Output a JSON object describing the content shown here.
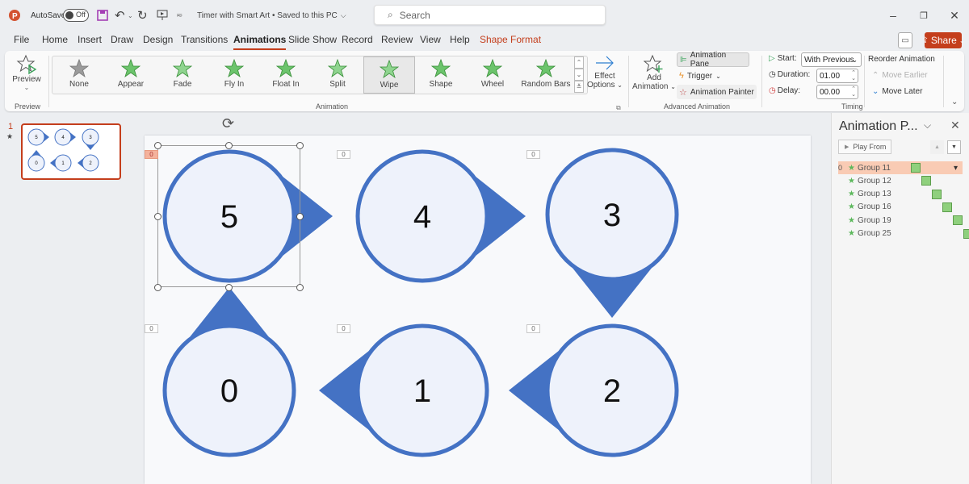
{
  "titlebar": {
    "app_icon": "powerpoint-logo",
    "autosave_label": "AutoSave",
    "autosave_state": "Off",
    "document_title": "Timer with Smart Art • Saved to this PC",
    "search_placeholder": "Search",
    "icons": [
      "save-icon",
      "undo-icon",
      "redo-icon",
      "present-icon",
      "customize-icon"
    ],
    "window_buttons": [
      "minimize",
      "restore",
      "close"
    ]
  },
  "menu": {
    "tabs": [
      "File",
      "Home",
      "Insert",
      "Draw",
      "Design",
      "Transitions",
      "Animations",
      "Slide Show",
      "Record",
      "Review",
      "View",
      "Help",
      "Shape Format"
    ],
    "active_tab": "Animations",
    "share_label": "Share"
  },
  "ribbon": {
    "preview": {
      "label": "Preview",
      "group": "Preview"
    },
    "animation_group_label": "Animation",
    "animations": [
      {
        "label": "None",
        "color": "#9b9b9b"
      },
      {
        "label": "Appear",
        "color": "#6cc46c"
      },
      {
        "label": "Fade",
        "color": "#8fd48f"
      },
      {
        "label": "Fly In",
        "color": "#6cc46c"
      },
      {
        "label": "Float In",
        "color": "#6cc46c"
      },
      {
        "label": "Split",
        "color": "#8fd48f"
      },
      {
        "label": "Wipe",
        "color": "#8fd48f"
      },
      {
        "label": "Shape",
        "color": "#6cc46c"
      },
      {
        "label": "Wheel",
        "color": "#6cc46c"
      },
      {
        "label": "Random Bars",
        "color": "#6cc46c"
      }
    ],
    "selected_animation": "Wipe",
    "effect_options": {
      "line1": "Effect",
      "line2": "Options"
    },
    "advanced": {
      "add_animation_1": "Add",
      "add_animation_2": "Animation",
      "animation_pane": "Animation Pane",
      "trigger": "Trigger",
      "animation_painter": "Animation Painter",
      "group_label": "Advanced Animation"
    },
    "timing": {
      "start_label": "Start:",
      "start_value": "With Previous",
      "duration_label": "Duration:",
      "duration_value": "01.00",
      "delay_label": "Delay:",
      "delay_value": "00.00",
      "group_label": "Timing"
    },
    "reorder": {
      "title": "Reorder Animation",
      "move_earlier": "Move Earlier",
      "move_later": "Move Later"
    }
  },
  "slides_panel": {
    "slide_number": "1",
    "has_animation_marker": "★",
    "thumbnail_digits": [
      "5",
      "4",
      "3",
      "0",
      "1",
      "2"
    ]
  },
  "slide": {
    "shape_fill": "#eef2fb",
    "shape_stroke": "#4472c4",
    "shapes": [
      {
        "digit": "5",
        "pointer": "right",
        "tag": "0",
        "selected": true
      },
      {
        "digit": "4",
        "pointer": "right",
        "tag": "0",
        "selected": false
      },
      {
        "digit": "3",
        "pointer": "down",
        "tag": "0",
        "selected": false
      },
      {
        "digit": "0",
        "pointer": "up",
        "tag": "0",
        "selected": false
      },
      {
        "digit": "1",
        "pointer": "left",
        "tag": "0",
        "selected": false
      },
      {
        "digit": "2",
        "pointer": "left",
        "tag": "0",
        "selected": false
      }
    ]
  },
  "animation_pane": {
    "title": "Animation P...",
    "play_from": "Play From",
    "items": [
      {
        "index": "0",
        "label": "Group 11",
        "selected": true
      },
      {
        "index": "",
        "label": "Group 12",
        "selected": false
      },
      {
        "index": "",
        "label": "Group 13",
        "selected": false
      },
      {
        "index": "",
        "label": "Group 16",
        "selected": false
      },
      {
        "index": "",
        "label": "Group 19",
        "selected": false
      },
      {
        "index": "",
        "label": "Group 25",
        "selected": false
      }
    ]
  }
}
